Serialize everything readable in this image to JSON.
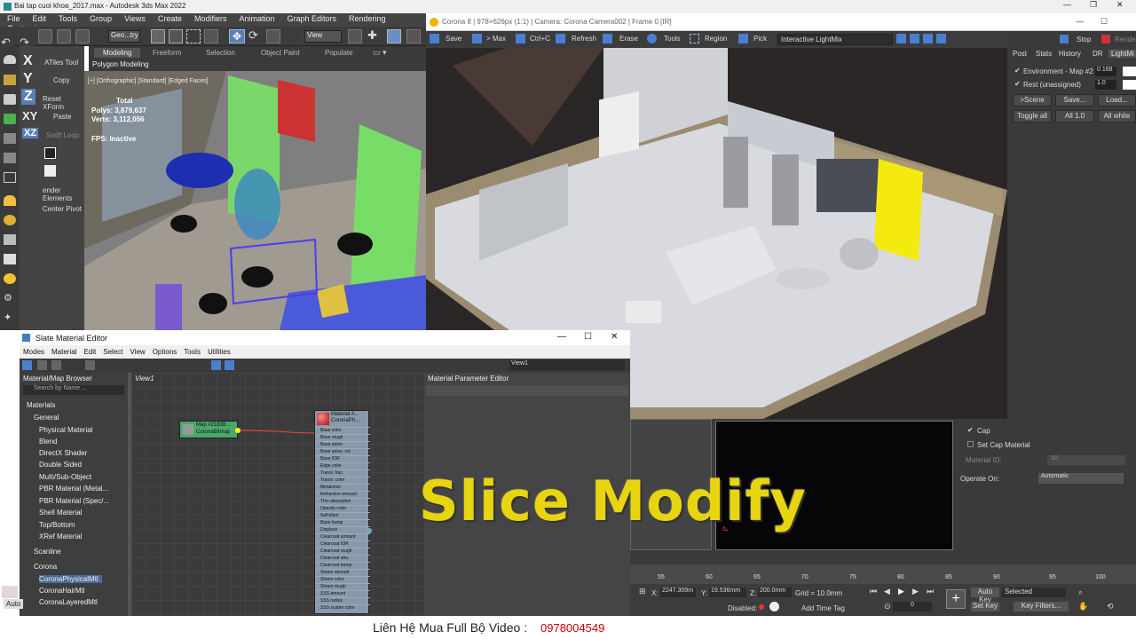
{
  "main_window": {
    "title": "Bai tap cuoi khoa_2017.max - Autodesk 3ds Max 2022",
    "menu": [
      "File",
      "Edit",
      "Tools",
      "Group",
      "Views",
      "Create",
      "Modifiers",
      "Animation",
      "Graph Editors",
      "Rendering",
      "Customiz"
    ],
    "toolbar": {
      "selection_filter": "Geo...try",
      "ref_coord": "View"
    },
    "ribbon_tabs": [
      "Modeling",
      "Freeform",
      "Selection",
      "Object Paint",
      "Populate"
    ],
    "ribbon_sub": "Polygon Modeling",
    "command_panel": [
      "ATiles Tool",
      "Copy",
      "Reset XForm",
      "Paste",
      "Swift Loop",
      "ender Elements",
      "Center Pivot"
    ],
    "side_letters": [
      "X",
      "Y",
      "Z",
      "XY",
      "XZ"
    ],
    "viewport": {
      "label": "[+] [Orthographic] [Standard] [Edged Faces]",
      "stats_title": "Total",
      "polys": "Polys: 3,879,637",
      "verts": "Verts: 3,112,056",
      "fps": "FPS:    Inactive"
    },
    "auto_label": "Auto"
  },
  "vfb": {
    "title": "Corona 8 | 978×626px (1:1) | Camera: Corona Camera002 | Frame 0 [IR]",
    "toolbar": [
      "Save",
      "> Max",
      "Ctrl+C",
      "Refresh",
      "Erase",
      "Tools",
      "Region",
      "Pick"
    ],
    "lightmix_dropdown": "Interactive LightMix",
    "stop": "Stop",
    "render_btn": "Rende",
    "side_tabs": [
      "Post",
      "Stats",
      "History",
      "DR",
      "LightMi"
    ],
    "env_label": "Environment - Map #2",
    "env_value": "0.168",
    "rest_label": "Rest (unassigned)",
    "rest_value": "1.0",
    "buttons_row1": [
      ">Scene",
      "Save...",
      "Load..."
    ],
    "buttons_row2": [
      "Toggle all",
      "All 1.0",
      "All white"
    ]
  },
  "slate": {
    "title": "Slate Material Editor",
    "menu": [
      "Modes",
      "Material",
      "Edit",
      "Select",
      "View",
      "Options",
      "Tools",
      "Utilities"
    ],
    "view_dropdown": "View1",
    "browser_title": "Material/Map Browser",
    "search": "Search by Name ...",
    "materials_header": "Materials",
    "general_header": "General",
    "general_items": [
      "Physical Material",
      "Blend",
      "DirectX Shader",
      "Double Sided",
      "Multi/Sub-Object",
      "PBR Material (Metal...",
      "PBR Material (Spec/...",
      "Shell Material",
      "Top/Bottom",
      "XRef Material"
    ],
    "scanline_header": "Scanline",
    "corona_header": "Corona",
    "corona_items": [
      "CoronaPhysicalMtl",
      "CoronaHairMtl",
      "CoronaLayeredMtl"
    ],
    "view_tab": "View1",
    "param_title": "Material Parameter Editor",
    "node_map": {
      "line1": "Map #21838...",
      "line2": "CoronaBitmap"
    },
    "node_mtl": {
      "line1": "Material #...",
      "line2": "CoronaPh..."
    },
    "slots": [
      "Base color",
      "Base rough",
      "Base aniso",
      "Base aniso. rot.",
      "Base IOR",
      "Edge color",
      "Transl. frac.",
      "Transl. color",
      "Metalness",
      "Refraction amount",
      "Thin absorption",
      "Opacity color",
      "Self-illum",
      "Base bump",
      "Displace",
      "Clearcoat amount",
      "Clearcoat IOR",
      "Clearcoat rough",
      "Clearcoat abs.",
      "Clearcoat bump",
      "Sheen amount",
      "Sheen color",
      "Sheen rough",
      "SSS amount",
      "SSS radius",
      "SSS scatter color"
    ]
  },
  "modifier_panel": {
    "cap": "Cap",
    "set_cap": "Set Cap Material",
    "material_id_label": "Material ID:",
    "material_id_value": "10",
    "operate_on_label": "Operate On:",
    "operate_on_value": "Automatic"
  },
  "timeline": {
    "ticks": [
      "55",
      "60",
      "65",
      "70",
      "75",
      "80",
      "85",
      "90",
      "95",
      "100"
    ]
  },
  "status": {
    "x_label": "X:",
    "x_value": "2247.309m",
    "y_label": "Y:",
    "y_value": "19.536mm",
    "z_label": "Z:",
    "z_value": "200.0mm",
    "grid": "Grid = 10.0mm",
    "disabled": "Disabled:",
    "add_time_tag": "Add Time Tag",
    "frame_value": "0",
    "auto_key": "Auto Key",
    "set_key": "Set Key",
    "selected": "Selected",
    "key_filters": "Key Filters..."
  },
  "overlay": {
    "headline": "Slice Modify",
    "contact_label": "Liên Hệ Mua Full Bộ Video :",
    "phone": "0978004549"
  }
}
